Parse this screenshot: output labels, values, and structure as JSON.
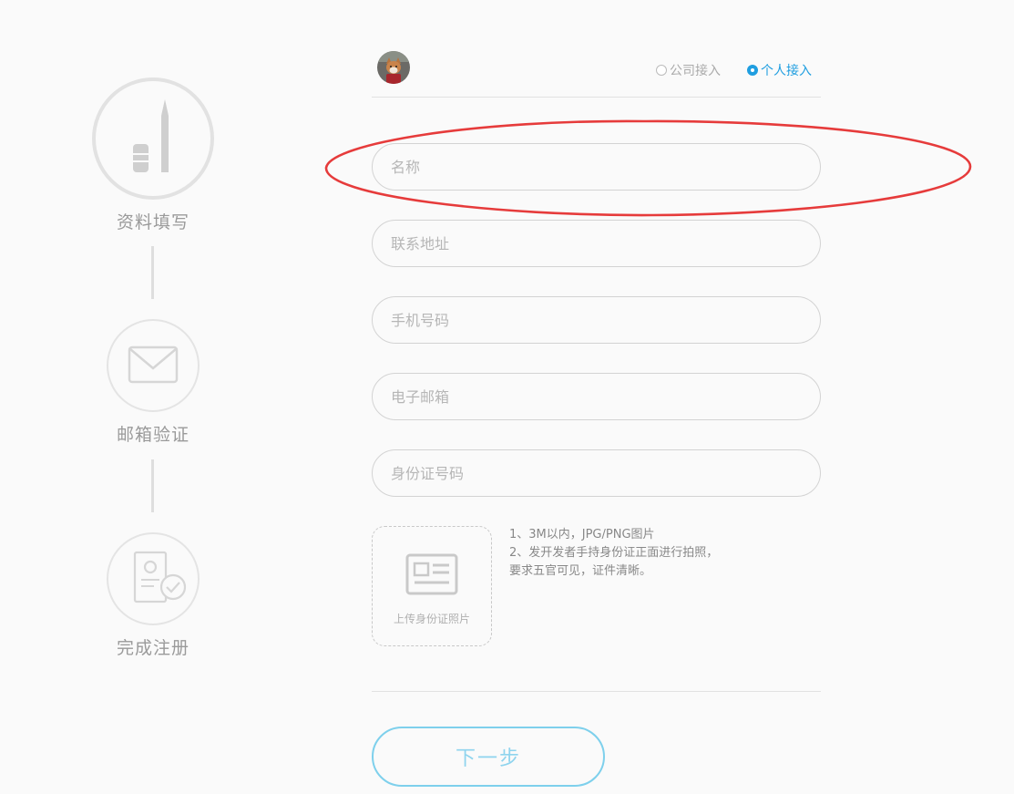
{
  "steps": [
    {
      "label": "资料填写",
      "icon": "pen-icon"
    },
    {
      "label": "邮箱验证",
      "icon": "envelope-icon"
    },
    {
      "label": "完成注册",
      "icon": "id-check-icon"
    }
  ],
  "header": {
    "avatar_icon": "shiba-dog-avatar",
    "access_options": [
      {
        "label": "公司接入",
        "selected": false
      },
      {
        "label": "个人接入",
        "selected": true
      }
    ]
  },
  "form": {
    "fields": [
      {
        "placeholder": "名称",
        "value": ""
      },
      {
        "placeholder": "联系地址",
        "value": ""
      },
      {
        "placeholder": "手机号码",
        "value": ""
      },
      {
        "placeholder": "电子邮箱",
        "value": ""
      },
      {
        "placeholder": "身份证号码",
        "value": ""
      }
    ],
    "upload": {
      "label": "上传身份证照片",
      "icon": "id-card-icon"
    },
    "tips": [
      "1、3M以内，JPG/PNG图片",
      "2、发开发者手持身份证正面进行拍照，",
      "要求五官可见，证件清晰。"
    ],
    "next_label": "下一步"
  },
  "colors": {
    "accent": "#1f9ee0",
    "annotation": "#e63b3b",
    "button_border": "#7ed0ec"
  }
}
